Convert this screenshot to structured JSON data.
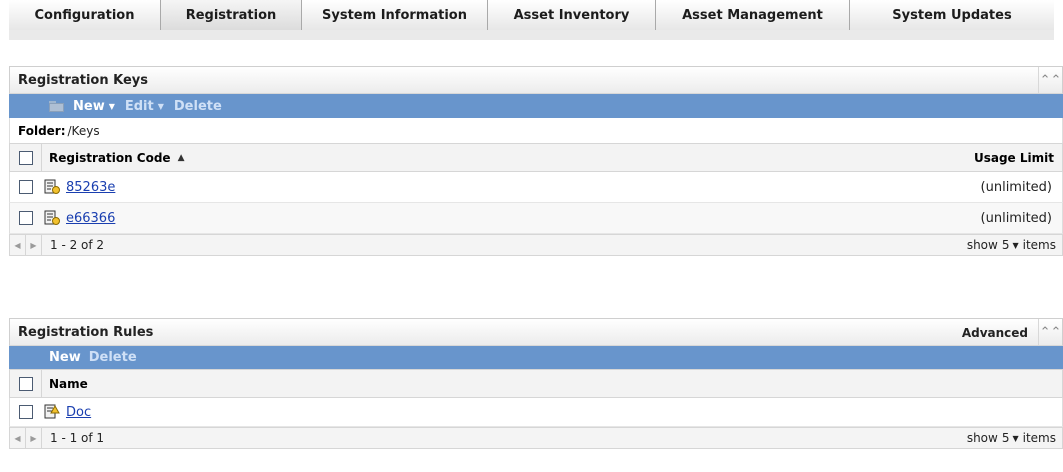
{
  "tabs": [
    {
      "label": "Configuration",
      "active": false
    },
    {
      "label": "Registration",
      "active": true
    },
    {
      "label": "System Information",
      "active": false
    },
    {
      "label": "Asset Inventory",
      "active": false
    },
    {
      "label": "Asset Management",
      "active": false
    },
    {
      "label": "System Updates",
      "active": false
    }
  ],
  "keys_panel": {
    "title": "Registration Keys",
    "collapse_icon": "double-chevron-up-icon",
    "toolbar": {
      "new": "New",
      "edit": "Edit",
      "delete": "Delete"
    },
    "folder_label": "Folder:",
    "folder_path": "/Keys",
    "columns": {
      "code": "Registration Code",
      "limit": "Usage Limit"
    },
    "rows": [
      {
        "code": "85263e",
        "limit": "(unlimited)"
      },
      {
        "code": "e66366",
        "limit": "(unlimited)"
      }
    ],
    "pager": {
      "range": "1 - 2 of 2",
      "show": "show",
      "count": "5",
      "items": "items"
    }
  },
  "rules_panel": {
    "title": "Registration Rules",
    "advanced": "Advanced",
    "collapse_icon": "double-chevron-up-icon",
    "toolbar": {
      "new": "New",
      "delete": "Delete"
    },
    "columns": {
      "name": "Name"
    },
    "rows": [
      {
        "name": "Doc"
      }
    ],
    "pager": {
      "range": "1 - 1 of 1",
      "show": "show",
      "count": "5",
      "items": "items"
    }
  },
  "colors": {
    "toolbar": "#6895cc",
    "link": "#1a3fb0"
  }
}
